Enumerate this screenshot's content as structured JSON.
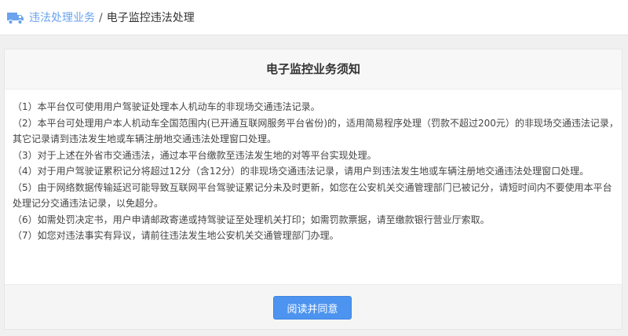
{
  "breadcrumb": {
    "icon": "truck-icon",
    "parent": "违法处理业务",
    "separator": "/",
    "current": "电子监控违法处理"
  },
  "notice": {
    "title": "电子监控业务须知",
    "items": [
      "（1）本平台仅可使用用户驾驶证处理本人机动车的非现场交通违法记录。",
      "（2）本平台可处理用户本人机动车全国范围内(已开通互联网服务平台省份)的，适用简易程序处理（罚款不超过200元）的非现场交通违法记录，其它记录请到违法发生地或车辆注册地交通违法处理窗口处理。",
      "（3）对于上述在外省市交通违法，通过本平台缴款至违法发生地的对等平台实现处理。",
      "（4）对于用户驾驶证累积记分将超过12分（含12分）的非现场交通违法记录，请用户到违法发生地或车辆注册地交通违法处理窗口处理。",
      "（5）由于网络数据传输延迟可能导致互联网平台驾驶证累记分未及时更新，如您在公安机关交通管理部门已被记分，请短时间内不要使用本平台处理记分交通违法记录，以免超分。",
      "（6）如需处罚决定书，用户申请邮政寄递或持驾驶证至处理机关打印；如需罚款票据，请至缴款银行营业厅索取。",
      "（7）如您对违法事实有异议，请前往违法发生地公安机关交通管理部门办理。"
    ]
  },
  "actions": {
    "agree_label": "阅读并同意"
  },
  "colors": {
    "accent": "#4d94f0",
    "link": "#6aa3ef"
  }
}
